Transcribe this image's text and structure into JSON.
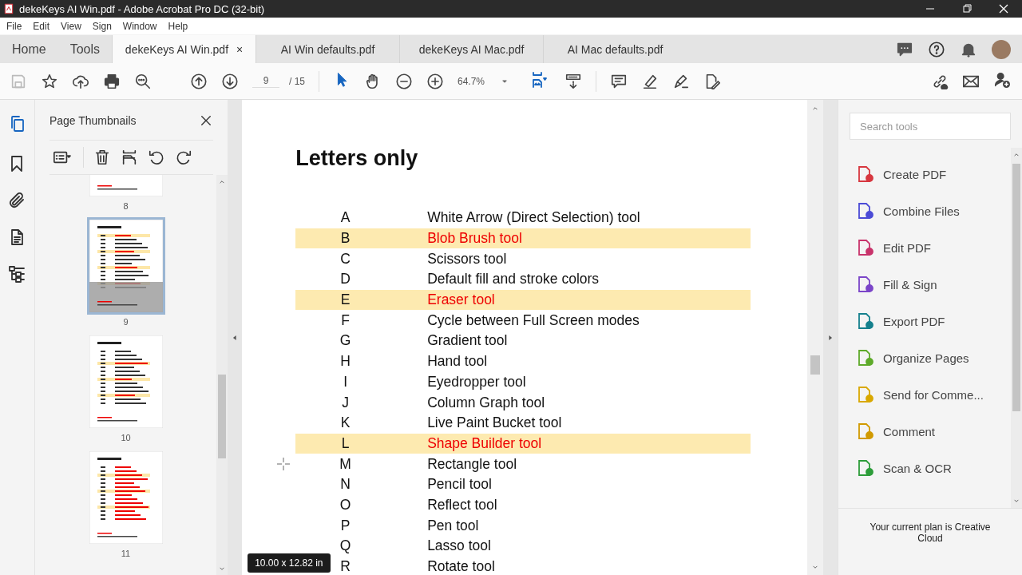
{
  "window": {
    "title": "dekeKeys AI Win.pdf - Adobe Acrobat Pro DC (32-bit)"
  },
  "menu": [
    "File",
    "Edit",
    "View",
    "Sign",
    "Window",
    "Help"
  ],
  "nav": [
    "Home",
    "Tools"
  ],
  "tabs": [
    {
      "label": "dekeKeys AI Win.pdf",
      "selected": true,
      "close": "×"
    },
    {
      "label": "AI Win defaults.pdf",
      "selected": false
    },
    {
      "label": "dekeKeys AI Mac.pdf",
      "selected": false
    },
    {
      "label": "AI Mac defaults.pdf",
      "selected": false
    }
  ],
  "toolbar": {
    "page": "9",
    "total": "/ 15",
    "zoom": "64.7%"
  },
  "thumbnails": {
    "title": "Page Thumbnails",
    "pages": [
      {
        "number": "8",
        "selected": false
      },
      {
        "number": "9",
        "selected": true
      },
      {
        "number": "10",
        "selected": false
      },
      {
        "number": "11",
        "selected": false
      }
    ]
  },
  "document": {
    "heading": "Letters only",
    "rows": [
      {
        "key": "A",
        "action": "White Arrow (Direct Selection) tool",
        "highlighted": false
      },
      {
        "key": "B",
        "action": "Blob Brush tool",
        "highlighted": true
      },
      {
        "key": "C",
        "action": "Scissors tool",
        "highlighted": false
      },
      {
        "key": "D",
        "action": "Default fill and stroke colors",
        "highlighted": false
      },
      {
        "key": "E",
        "action": "Eraser tool",
        "highlighted": true
      },
      {
        "key": "F",
        "action": "Cycle between Full Screen modes",
        "highlighted": false
      },
      {
        "key": "G",
        "action": "Gradient tool",
        "highlighted": false
      },
      {
        "key": "H",
        "action": "Hand tool",
        "highlighted": false
      },
      {
        "key": "I",
        "action": "Eyedropper tool",
        "highlighted": false
      },
      {
        "key": "J",
        "action": "Column Graph tool",
        "highlighted": false
      },
      {
        "key": "K",
        "action": "Live Paint Bucket tool",
        "highlighted": false
      },
      {
        "key": "L",
        "action": "Shape Builder tool",
        "highlighted": true
      },
      {
        "key": "M",
        "action": "Rectangle tool",
        "highlighted": false
      },
      {
        "key": "N",
        "action": "Pencil tool",
        "highlighted": false
      },
      {
        "key": "O",
        "action": "Reflect tool",
        "highlighted": false
      },
      {
        "key": "P",
        "action": "Pen tool",
        "highlighted": false
      },
      {
        "key": "Q",
        "action": "Lasso tool",
        "highlighted": false
      },
      {
        "key": "R",
        "action": "Rotate tool",
        "highlighted": false
      }
    ],
    "size_tooltip": "10.00 x 12.82 in"
  },
  "tools_pane": {
    "search": {
      "placeholder": "Search tools"
    },
    "tools": [
      {
        "label": "Create PDF",
        "color": "#d7373f"
      },
      {
        "label": "Combine Files",
        "color": "#4b4bd6"
      },
      {
        "label": "Edit PDF",
        "color": "#c8336b"
      },
      {
        "label": "Fill & Sign",
        "color": "#7b45c8"
      },
      {
        "label": "Export PDF",
        "color": "#15808d"
      },
      {
        "label": "Organize Pages",
        "color": "#5eaa2a"
      },
      {
        "label": "Send for Comme...",
        "color": "#d9a800"
      },
      {
        "label": "Comment",
        "color": "#d19a00"
      },
      {
        "label": "Scan & OCR",
        "color": "#2d9d3a"
      }
    ],
    "plan": "Your current plan is Creative Cloud"
  }
}
